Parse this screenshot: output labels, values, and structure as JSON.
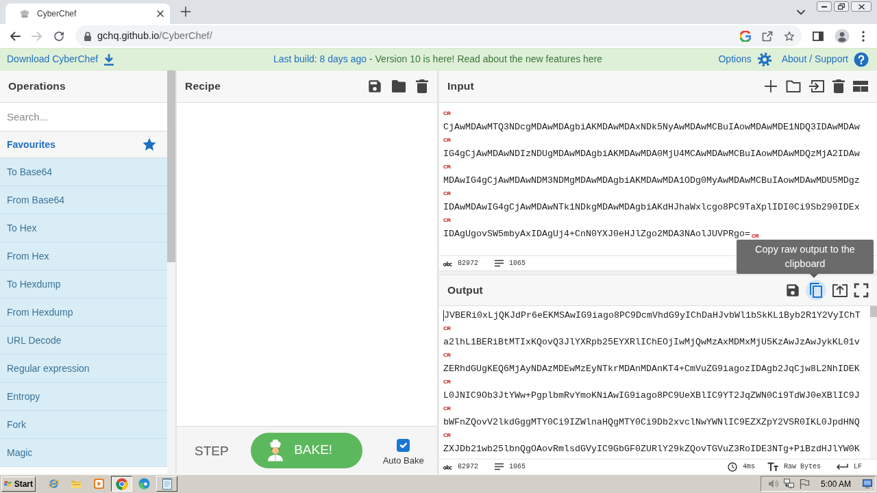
{
  "browser": {
    "tab": {
      "title": "CyberChef"
    },
    "forward_disabled": true,
    "url": {
      "host": "gchq.github.io",
      "path": "/CyberChef/"
    }
  },
  "banner": {
    "download": "Download CyberChef",
    "build": "Last build: 8 days ago",
    "notice": "- Version 10 is here! Read about the new features here",
    "options": "Options",
    "about": "About / Support"
  },
  "operations": {
    "title": "Operations",
    "search": {
      "placeholder": "Search..."
    },
    "favourites": "Favourites",
    "items": [
      "To Base64",
      "From Base64",
      "To Hex",
      "From Hex",
      "To Hexdump",
      "From Hexdump",
      "URL Decode",
      "Regular expression",
      "Entropy",
      "Fork",
      "Magic"
    ]
  },
  "recipe": {
    "title": "Recipe",
    "step": "STEP",
    "bake": "BAKE!",
    "auto_bake": {
      "label": "Auto Bake",
      "checked": true
    }
  },
  "input": {
    "title": "Input",
    "lines": [
      {
        "cr_above": "CR",
        "text": "CjAwMDAwMTQ3NDcgMDAwMDAgbiAKMDAwMDAxNDk5NyAwMDAwMCBuIAowMDAwMDE1NDQ3IDAwMDAw"
      },
      {
        "cr_above": "CR",
        "text": "IG4gCjAwMDAwNDIzNDUgMDAwMDAgbiAKMDAwMDA0MjU4MCAwMDAwMCBuIAowMDAwMDQzMjA2IDAw"
      },
      {
        "cr_above": "CR",
        "text": "MDAwIG4gCjAwMDAwNDM3NDMgMDAwMDAgbiAKMDAwMDA1ODg0MyAwMDAwMCBuIAowMDAwMDU5MDgz"
      },
      {
        "cr_above": "CR",
        "text": "IDAwMDAwIG4gCjAwMDAwNTk1NDkgMDAwMDAgbiAKdHJhaWxlcgo8PC9TaXplIDI0Ci9Sb290IDEx"
      },
      {
        "cr_above": "CR",
        "text": "IDAgUgovSW5mbyAxIDAgUj4+CnN0YXJ0eHJlZgo2MDA3NAolJUVPRgo=",
        "cr_end": "CR"
      }
    ],
    "status": {
      "characters": "82972",
      "lines": "1065"
    }
  },
  "output": {
    "title": "Output",
    "copy_highlighted": true,
    "tooltip": "Copy raw output to the clipboard",
    "lines": [
      {
        "cursor": true,
        "text": "JVBERi0xLjQKJdPr6eEKMSAwIG9iago8PC9DcmVhdG9yIChDaHJvbWl1bSkKL1Byb2R1Y2VyIChT"
      },
      {
        "cr_above": "CR",
        "text": "a2lhL1BERiBtMTIxKQovQ3JlYXRpb25EYXRlIChEOjIwMjQwMzAxMDMxMjU5KzAwJzAwJykKL01v"
      },
      {
        "cr_above": "CR",
        "text": "ZERhdGUgKEQ6MjAyNDAzMDEwMzEyNTkrMDAnMDAnKT4+CmVuZG9iagozIDAgb2JqCjw8L2NhIDEK"
      },
      {
        "cr_above": "CR",
        "text": "L0JNIC9Ob3JtYWw+PgplbmRvYmoKNiAwIG9iago8PC9UeXBlIC9YT2JqZWN0Ci9TdWJ0eXBlIC9J"
      },
      {
        "cr_above": "CR",
        "text": "bWFnZQovV2lkdGggMTY0Ci9IZWlnaHQgMTY0Ci9Db2xvclNwYWNlIC9EZXZpY2VSR0IKL0JpdHNQ"
      },
      {
        "cr_above": "CR",
        "text": "ZXJDb21wb25lbnQgOAovRmlsdGVyIC9GbGF0ZURlY29kZQovTGVuZ3RoIDE3NTg+PiBzdHJlYW0K"
      }
    ],
    "status": {
      "characters": "82972",
      "lines": "1065",
      "time": "4ms",
      "encoding": "Raw Bytes",
      "eol": "LF"
    }
  },
  "taskbar": {
    "start": "Start",
    "apps": [
      {
        "kind": "ie",
        "active": false,
        "running": false
      },
      {
        "kind": "explorer",
        "active": false,
        "running": false
      },
      {
        "kind": "media",
        "active": false,
        "running": false
      },
      {
        "kind": "chrome",
        "active": true,
        "running": true
      },
      {
        "kind": "edge",
        "active": false,
        "running": false
      },
      {
        "kind": "notepad",
        "active": false,
        "running": true
      }
    ],
    "clock": "5:00 AM"
  }
}
